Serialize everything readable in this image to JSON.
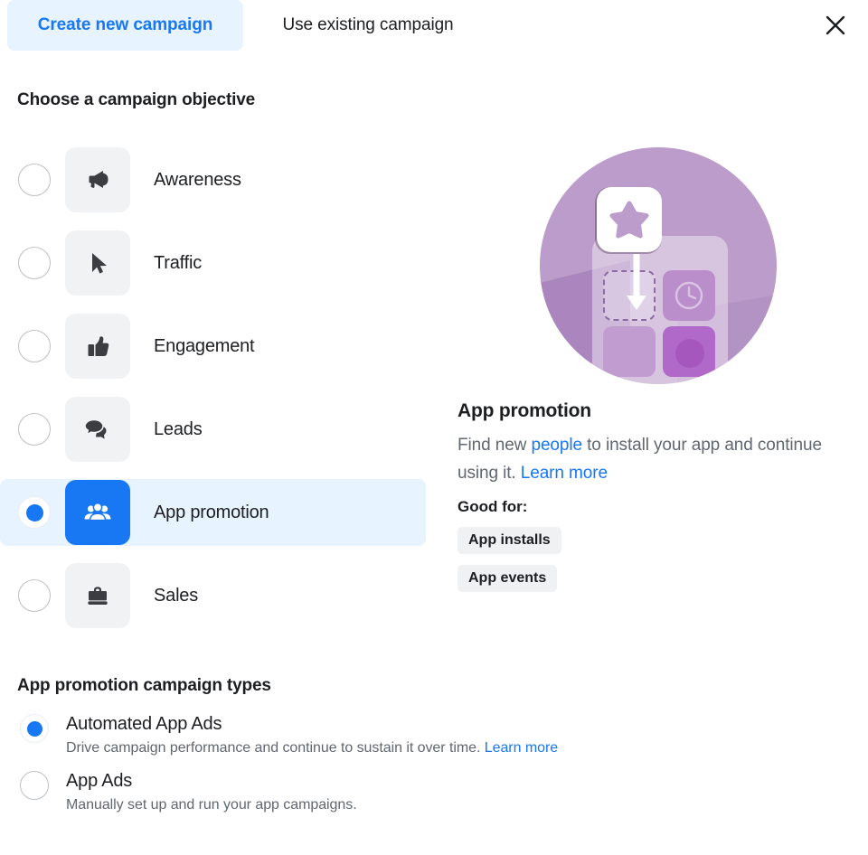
{
  "tabs": [
    {
      "label": "Create new campaign",
      "active": true,
      "name": "tab-create-new-campaign"
    },
    {
      "label": "Use existing campaign",
      "active": false,
      "name": "tab-use-existing-campaign"
    }
  ],
  "close_label": "Close",
  "objective_section": {
    "title": "Choose a campaign objective",
    "items": [
      {
        "label": "Awareness",
        "icon": "megaphone-icon",
        "selected": false
      },
      {
        "label": "Traffic",
        "icon": "cursor-arrow-icon",
        "selected": false
      },
      {
        "label": "Engagement",
        "icon": "thumbs-up-icon",
        "selected": false
      },
      {
        "label": "Leads",
        "icon": "speech-bubbles-icon",
        "selected": false
      },
      {
        "label": "App promotion",
        "icon": "people-group-icon",
        "selected": true
      },
      {
        "label": "Sales",
        "icon": "briefcase-icon",
        "selected": false
      }
    ]
  },
  "detail": {
    "illustration": "app-promotion-illustration",
    "title": "App promotion",
    "desc_part1": "Find new ",
    "desc_link1": "people",
    "desc_part2": " to install your app and continue using it. ",
    "desc_link2": "Learn more",
    "good_for_label": "Good for:",
    "chips": [
      "App installs",
      "App events"
    ]
  },
  "types_section": {
    "title": "App promotion campaign types",
    "items": [
      {
        "label": "Automated App Ads",
        "desc": "Drive campaign performance and continue to sustain it over time. ",
        "link": "Learn more",
        "selected": true
      },
      {
        "label": "App Ads",
        "desc": "Manually set up and run your app campaigns.",
        "link": "",
        "selected": false
      }
    ]
  },
  "colors": {
    "accent_blue": "#1877f2",
    "tab_highlight": "#e7f3ff",
    "row_highlight": "#e7f3ff",
    "tile_gray": "#f1f2f4",
    "text_primary": "#1c1e21",
    "text_secondary": "#606770",
    "illustration_purple": "#bb9cca"
  }
}
